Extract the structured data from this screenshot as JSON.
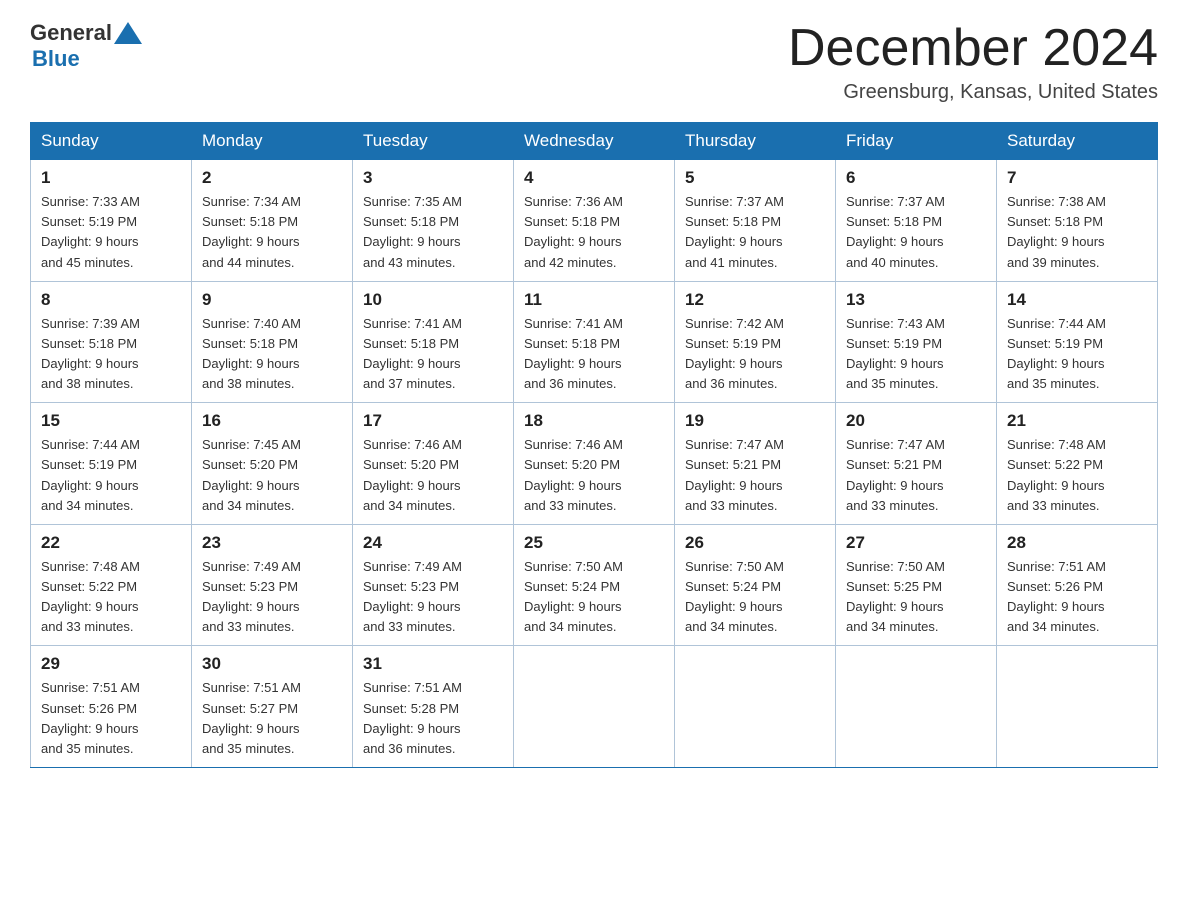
{
  "header": {
    "logo_general": "General",
    "logo_blue": "Blue",
    "month_year": "December 2024",
    "location": "Greensburg, Kansas, United States"
  },
  "weekdays": [
    "Sunday",
    "Monday",
    "Tuesday",
    "Wednesday",
    "Thursday",
    "Friday",
    "Saturday"
  ],
  "weeks": [
    [
      {
        "day": "1",
        "sunrise": "7:33 AM",
        "sunset": "5:19 PM",
        "daylight": "9 hours and 45 minutes."
      },
      {
        "day": "2",
        "sunrise": "7:34 AM",
        "sunset": "5:18 PM",
        "daylight": "9 hours and 44 minutes."
      },
      {
        "day": "3",
        "sunrise": "7:35 AM",
        "sunset": "5:18 PM",
        "daylight": "9 hours and 43 minutes."
      },
      {
        "day": "4",
        "sunrise": "7:36 AM",
        "sunset": "5:18 PM",
        "daylight": "9 hours and 42 minutes."
      },
      {
        "day": "5",
        "sunrise": "7:37 AM",
        "sunset": "5:18 PM",
        "daylight": "9 hours and 41 minutes."
      },
      {
        "day": "6",
        "sunrise": "7:37 AM",
        "sunset": "5:18 PM",
        "daylight": "9 hours and 40 minutes."
      },
      {
        "day": "7",
        "sunrise": "7:38 AM",
        "sunset": "5:18 PM",
        "daylight": "9 hours and 39 minutes."
      }
    ],
    [
      {
        "day": "8",
        "sunrise": "7:39 AM",
        "sunset": "5:18 PM",
        "daylight": "9 hours and 38 minutes."
      },
      {
        "day": "9",
        "sunrise": "7:40 AM",
        "sunset": "5:18 PM",
        "daylight": "9 hours and 38 minutes."
      },
      {
        "day": "10",
        "sunrise": "7:41 AM",
        "sunset": "5:18 PM",
        "daylight": "9 hours and 37 minutes."
      },
      {
        "day": "11",
        "sunrise": "7:41 AM",
        "sunset": "5:18 PM",
        "daylight": "9 hours and 36 minutes."
      },
      {
        "day": "12",
        "sunrise": "7:42 AM",
        "sunset": "5:19 PM",
        "daylight": "9 hours and 36 minutes."
      },
      {
        "day": "13",
        "sunrise": "7:43 AM",
        "sunset": "5:19 PM",
        "daylight": "9 hours and 35 minutes."
      },
      {
        "day": "14",
        "sunrise": "7:44 AM",
        "sunset": "5:19 PM",
        "daylight": "9 hours and 35 minutes."
      }
    ],
    [
      {
        "day": "15",
        "sunrise": "7:44 AM",
        "sunset": "5:19 PM",
        "daylight": "9 hours and 34 minutes."
      },
      {
        "day": "16",
        "sunrise": "7:45 AM",
        "sunset": "5:20 PM",
        "daylight": "9 hours and 34 minutes."
      },
      {
        "day": "17",
        "sunrise": "7:46 AM",
        "sunset": "5:20 PM",
        "daylight": "9 hours and 34 minutes."
      },
      {
        "day": "18",
        "sunrise": "7:46 AM",
        "sunset": "5:20 PM",
        "daylight": "9 hours and 33 minutes."
      },
      {
        "day": "19",
        "sunrise": "7:47 AM",
        "sunset": "5:21 PM",
        "daylight": "9 hours and 33 minutes."
      },
      {
        "day": "20",
        "sunrise": "7:47 AM",
        "sunset": "5:21 PM",
        "daylight": "9 hours and 33 minutes."
      },
      {
        "day": "21",
        "sunrise": "7:48 AM",
        "sunset": "5:22 PM",
        "daylight": "9 hours and 33 minutes."
      }
    ],
    [
      {
        "day": "22",
        "sunrise": "7:48 AM",
        "sunset": "5:22 PM",
        "daylight": "9 hours and 33 minutes."
      },
      {
        "day": "23",
        "sunrise": "7:49 AM",
        "sunset": "5:23 PM",
        "daylight": "9 hours and 33 minutes."
      },
      {
        "day": "24",
        "sunrise": "7:49 AM",
        "sunset": "5:23 PM",
        "daylight": "9 hours and 33 minutes."
      },
      {
        "day": "25",
        "sunrise": "7:50 AM",
        "sunset": "5:24 PM",
        "daylight": "9 hours and 34 minutes."
      },
      {
        "day": "26",
        "sunrise": "7:50 AM",
        "sunset": "5:24 PM",
        "daylight": "9 hours and 34 minutes."
      },
      {
        "day": "27",
        "sunrise": "7:50 AM",
        "sunset": "5:25 PM",
        "daylight": "9 hours and 34 minutes."
      },
      {
        "day": "28",
        "sunrise": "7:51 AM",
        "sunset": "5:26 PM",
        "daylight": "9 hours and 34 minutes."
      }
    ],
    [
      {
        "day": "29",
        "sunrise": "7:51 AM",
        "sunset": "5:26 PM",
        "daylight": "9 hours and 35 minutes."
      },
      {
        "day": "30",
        "sunrise": "7:51 AM",
        "sunset": "5:27 PM",
        "daylight": "9 hours and 35 minutes."
      },
      {
        "day": "31",
        "sunrise": "7:51 AM",
        "sunset": "5:28 PM",
        "daylight": "9 hours and 36 minutes."
      },
      null,
      null,
      null,
      null
    ]
  ],
  "labels": {
    "sunrise": "Sunrise:",
    "sunset": "Sunset:",
    "daylight": "Daylight:"
  }
}
